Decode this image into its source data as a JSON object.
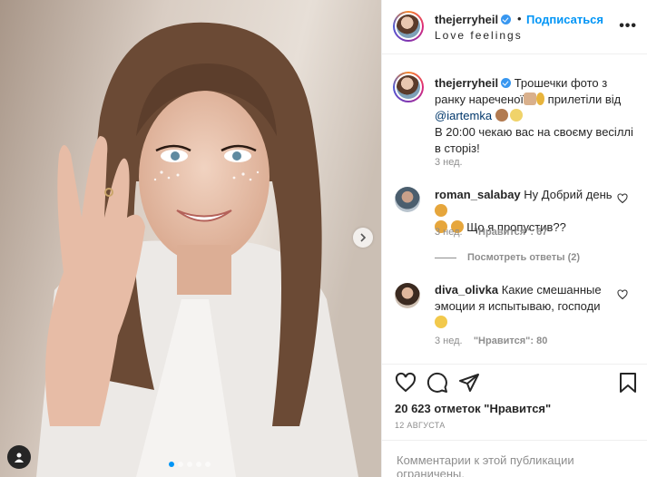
{
  "post": {
    "username": "thejerryheil",
    "bullet": "•",
    "follow_label": "Подписаться",
    "location": "Love feelings",
    "more_label": "•••"
  },
  "caption": {
    "username": "thejerryheil",
    "text_part1": " Трошечки фото з ранку нареченої",
    "text_part2": " прилетіли від ",
    "mention": "@iartemka",
    "text_part3": " ",
    "text_part4": "В 20:00 чекаю вас на своєму весіллі в сторіз!",
    "time": "3 нед."
  },
  "comments": [
    {
      "username": "roman_salabay",
      "text": " Ну Добрий день ",
      "text2": " Що я пропустив??",
      "time": "3 нед.",
      "likes": "\"Нравится\": 67",
      "replies": "Посмотреть ответы (2)"
    },
    {
      "username": "diva_olivka",
      "text": " Какие смешанные эмоции я испытываю, господи ",
      "time": "3 нед.",
      "likes": "\"Нравится\": 80"
    }
  ],
  "footer": {
    "likes": "20 623 отметок \"Нравится\"",
    "date": "12 АВГУСТА",
    "limited": "Комментарии к этой публикации ограничены."
  },
  "carousel": {
    "slides": 5,
    "active": 0
  },
  "icons": {
    "heart": "heart-icon",
    "comment": "comment-icon",
    "share": "share-icon",
    "bookmark": "bookmark-icon",
    "next": "chevron-right-icon",
    "user_tags": "user-icon"
  },
  "colors": {
    "link": "#0095f6",
    "verified": "#3897f0",
    "muted": "#8e8e8e"
  }
}
